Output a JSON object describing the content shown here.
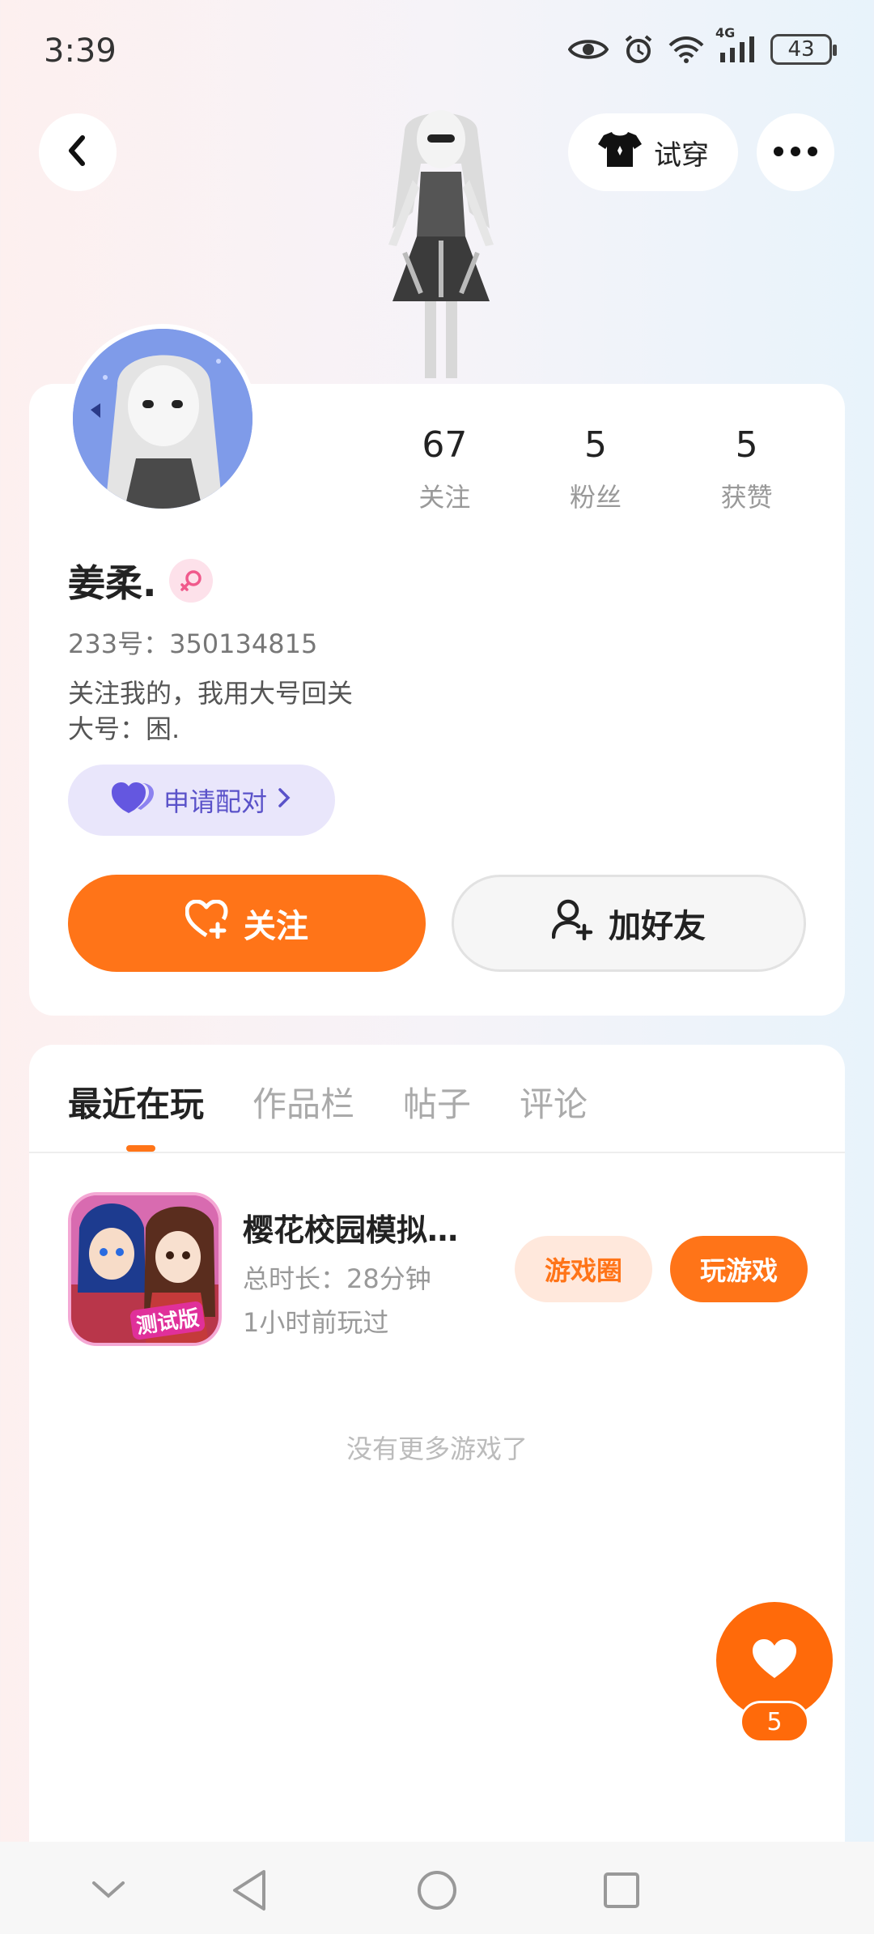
{
  "status_bar": {
    "time": "3:39",
    "network": "4G",
    "battery": "43",
    "icons": [
      "eye-icon",
      "alarm-icon",
      "wifi-icon",
      "cellular-signal-icon",
      "battery-icon"
    ]
  },
  "header": {
    "tryon_label": "试穿",
    "icons": [
      "back-arrow-icon",
      "tshirt-icon",
      "more-dots-icon"
    ]
  },
  "profile": {
    "stats": [
      {
        "value": "67",
        "label": "关注"
      },
      {
        "value": "5",
        "label": "粉丝"
      },
      {
        "value": "5",
        "label": "获赞"
      }
    ],
    "name": "姜柔.",
    "gender_icon": "female-symbol-icon",
    "id_text": "233号：350134815",
    "bio_line1": "关注我的，我用大号回关",
    "bio_line2": "大号：困.",
    "pair_label": "申请配对",
    "follow_label": "关注",
    "add_friend_label": "加好友"
  },
  "tabs": [
    {
      "label": "最近在玩",
      "active": true
    },
    {
      "label": "作品栏",
      "active": false
    },
    {
      "label": "帖子",
      "active": false
    },
    {
      "label": "评论",
      "active": false
    }
  ],
  "game": {
    "title": "樱花校园模拟…",
    "duration": "总时长：28分钟",
    "last_played": "1小时前玩过",
    "badge": "测试版",
    "circle_label": "游戏圈",
    "play_label": "玩游戏"
  },
  "no_more_text": "没有更多游戏了",
  "like": {
    "count": "5",
    "icon": "heart-icon"
  },
  "nav": {
    "icons": [
      "chevron-down-icon",
      "back-triangle-icon",
      "home-circle-icon",
      "recents-square-icon"
    ]
  },
  "colors": {
    "accent": "#ff7418",
    "pair_bg": "#e9e6fb",
    "pair_text": "#5a52c9",
    "gender": "#f05a8c"
  }
}
